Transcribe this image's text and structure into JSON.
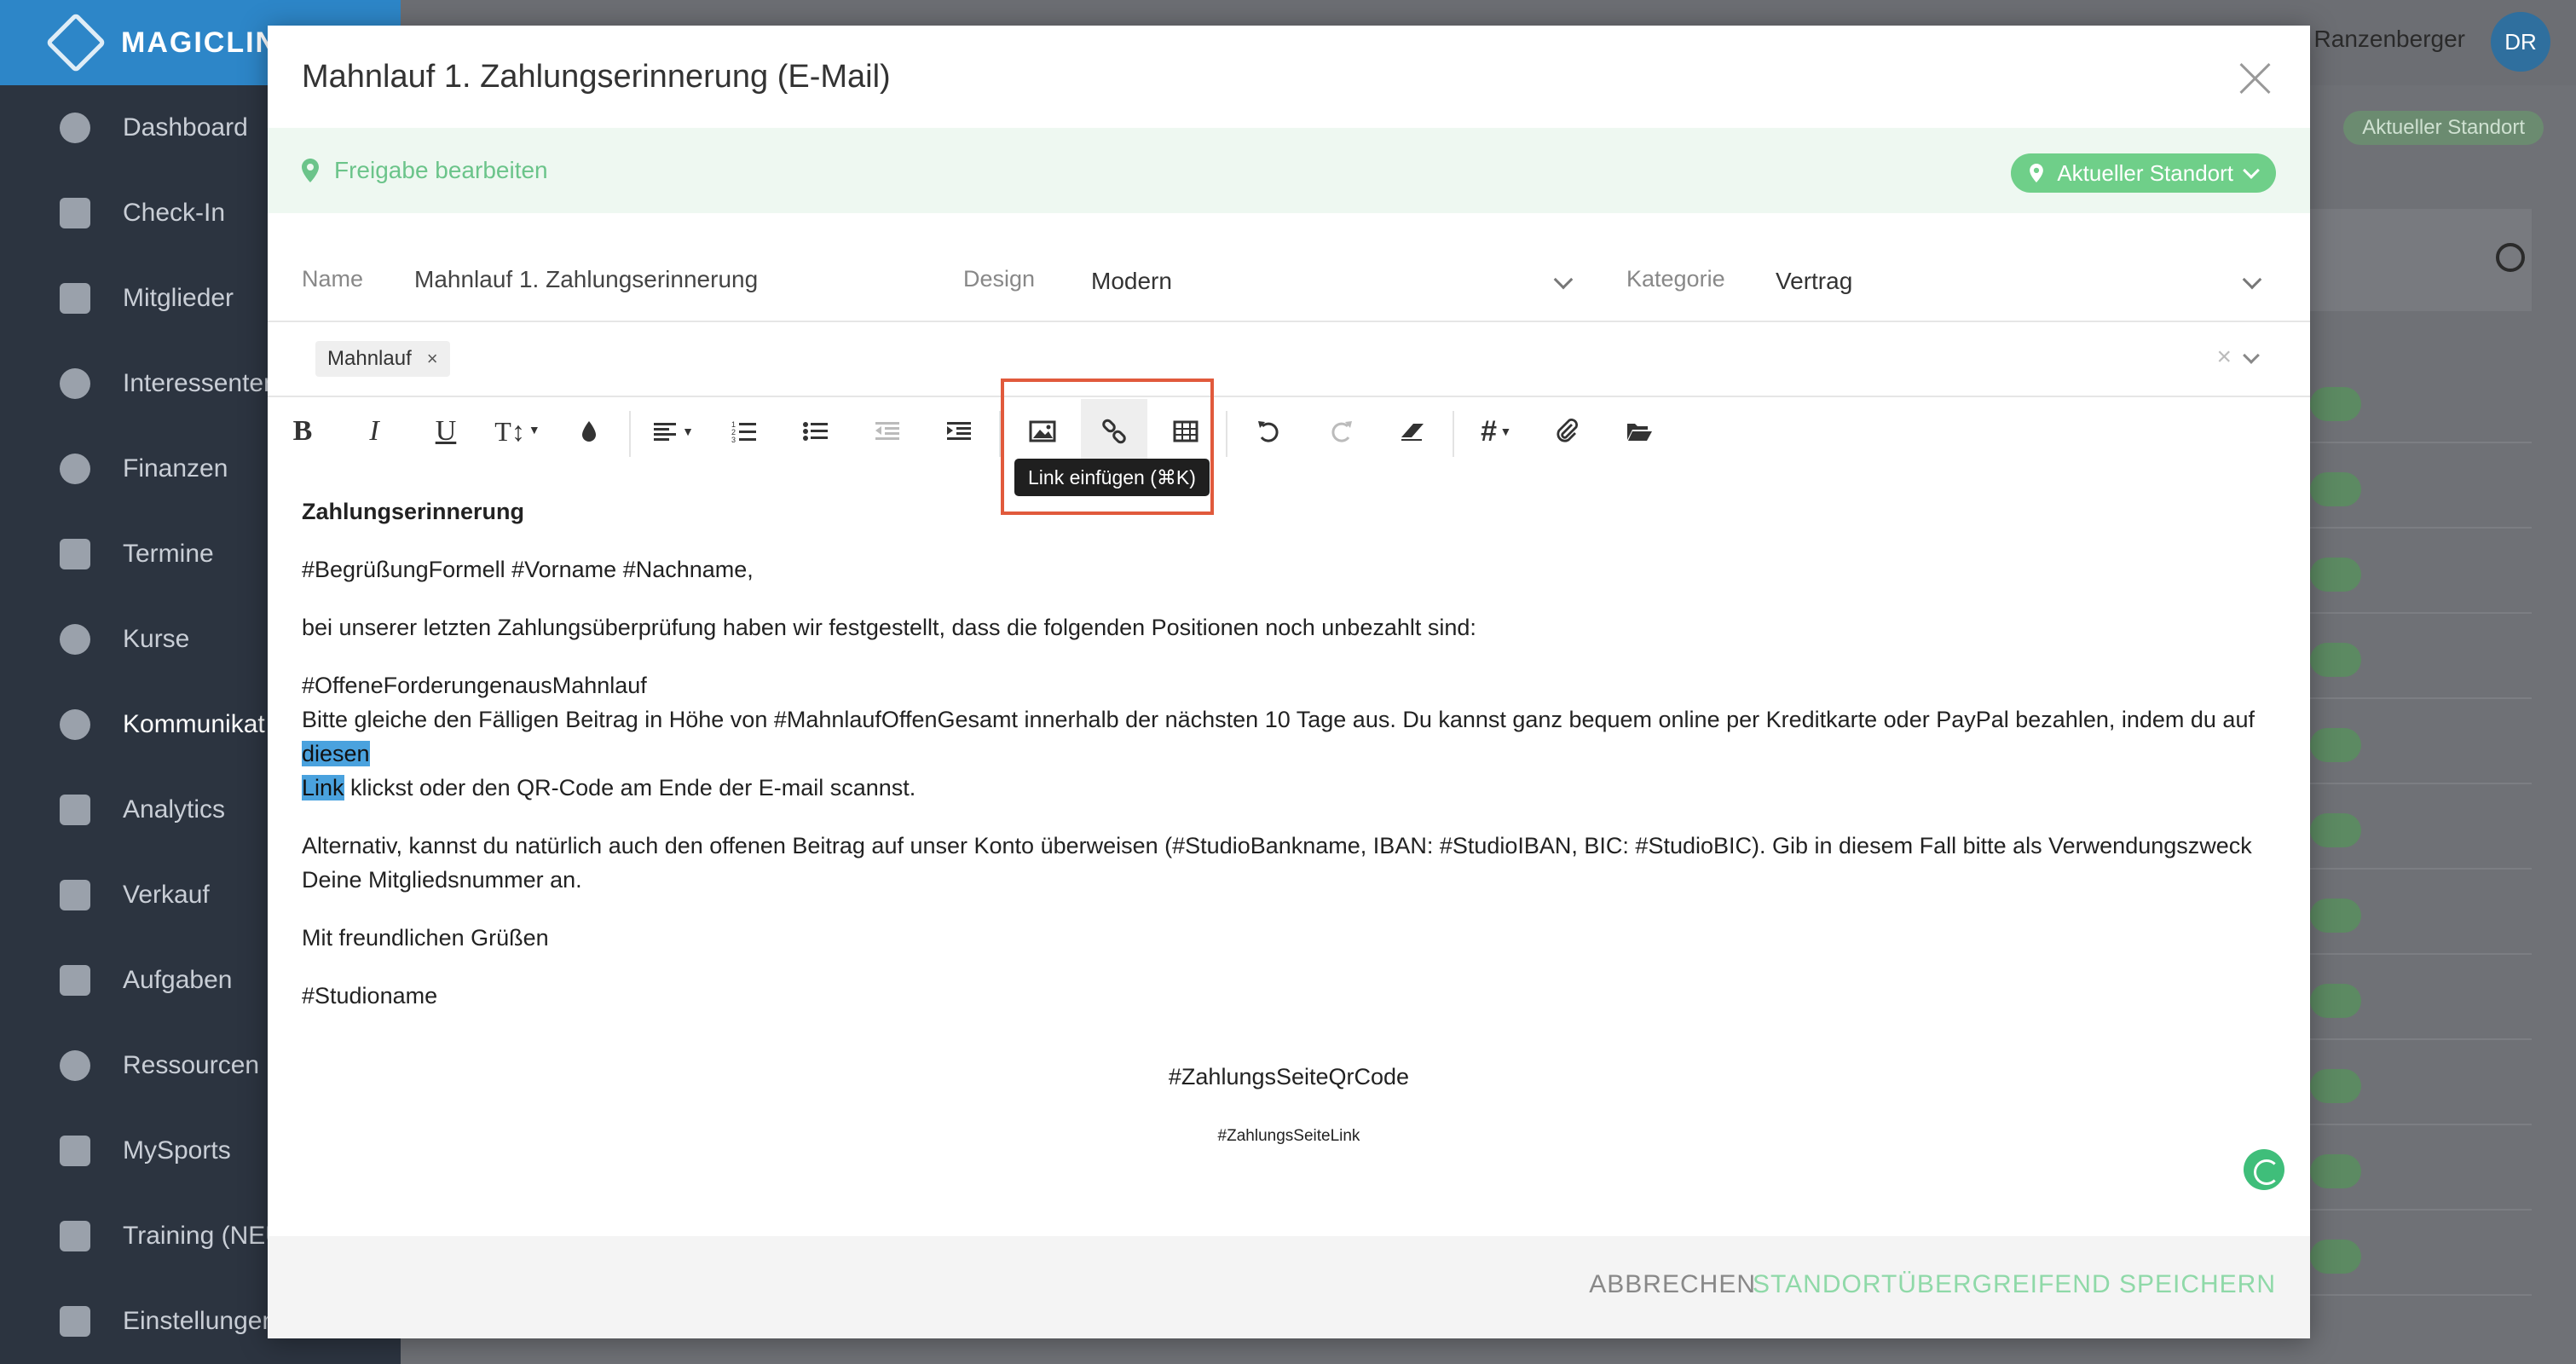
{
  "app": {
    "logo_text": "MAGICLIN"
  },
  "sidebar": {
    "items": [
      {
        "label": "Dashboard",
        "icon": "dashboard-icon"
      },
      {
        "label": "Check-In",
        "icon": "checkin-icon"
      },
      {
        "label": "Mitglieder",
        "icon": "members-icon"
      },
      {
        "label": "Interessenten",
        "icon": "leads-icon"
      },
      {
        "label": "Finanzen",
        "icon": "finance-icon"
      },
      {
        "label": "Termine",
        "icon": "calendar-icon"
      },
      {
        "label": "Kurse",
        "icon": "stopwatch-icon"
      },
      {
        "label": "Kommunikat",
        "icon": "chat-icon"
      },
      {
        "label": "Analytics",
        "icon": "chart-icon"
      },
      {
        "label": "Verkauf",
        "icon": "cart-icon"
      },
      {
        "label": "Aufgaben",
        "icon": "checkbox-icon"
      },
      {
        "label": "Ressourcen",
        "icon": "users-icon"
      },
      {
        "label": "MySports",
        "icon": "dots-icon"
      },
      {
        "label": "Training (NEU",
        "icon": "dumbbell-icon"
      },
      {
        "label": "Einstellungen",
        "icon": "sliders-icon"
      }
    ]
  },
  "topbar": {
    "user_name": "n Ranzenberger",
    "avatar_initials": "DR",
    "standort_label": "Aktueller Standort"
  },
  "modal": {
    "title": "Mahnlauf 1. Zahlungserinnerung (E-Mail)",
    "release_link": "Freigabe bearbeiten",
    "standort_label": "Aktueller Standort",
    "fields": {
      "name_label": "Name",
      "name_value": "Mahnlauf 1. Zahlungserinnerung",
      "design_label": "Design",
      "design_value": "Modern",
      "kategorie_label": "Kategorie",
      "kategorie_value": "Vertrag"
    },
    "tags": [
      "Mahnlauf"
    ],
    "tag_remove": "×",
    "tags_clear": "×",
    "toolbar": {
      "bold": "B",
      "italic": "I",
      "underline": "U",
      "text_size": "T↕",
      "hash": "#",
      "tooltip": "Link einfügen (⌘K)"
    },
    "content": {
      "heading": "Zahlungserinnerung",
      "greeting": "#BegrüßungFormell #Vorname #Nachname,",
      "p1": "bei unserer letzten Zahlungsüberprüfung haben wir festgestellt, dass die folgenden Positionen noch unbezahlt sind:",
      "p2_line1": "#OffeneForderungenausMahnlauf",
      "p2_before_link": "Bitte gleiche den Fälligen Beitrag in Höhe von #MahnlaufOffenGesamt innerhalb der nächsten 10 Tage aus. Du kannst ganz bequem online per Kreditkarte oder PayPal bezahlen, indem du auf ",
      "p2_link_part1": "diesen",
      "p2_link_part2": "Link",
      "p2_after_link": " klickst oder den QR-Code am Ende der E-mail scannst.",
      "p3": "Alternativ, kannst du natürlich auch den offenen Beitrag auf unser Konto überweisen (#StudioBankname, IBAN: #StudioIBAN, BIC: #StudioBIC). Gib in diesem Fall bitte als Verwendungszweck Deine Mitgliedsnummer an.",
      "closing": "Mit freundlichen Grüßen",
      "signature": "#Studioname",
      "qr_code": "#ZahlungsSeiteQrCode",
      "payment_link": "#ZahlungsSeiteLink"
    },
    "footer": {
      "cancel": "ABBRECHEN",
      "save": "STANDORTÜBERGREIFEND SPEICHERN"
    }
  },
  "colors": {
    "brand_blue": "#2d86c8",
    "green": "#6fcf89",
    "highlight_red": "#e15a3c",
    "selection": "#4aa2de"
  }
}
